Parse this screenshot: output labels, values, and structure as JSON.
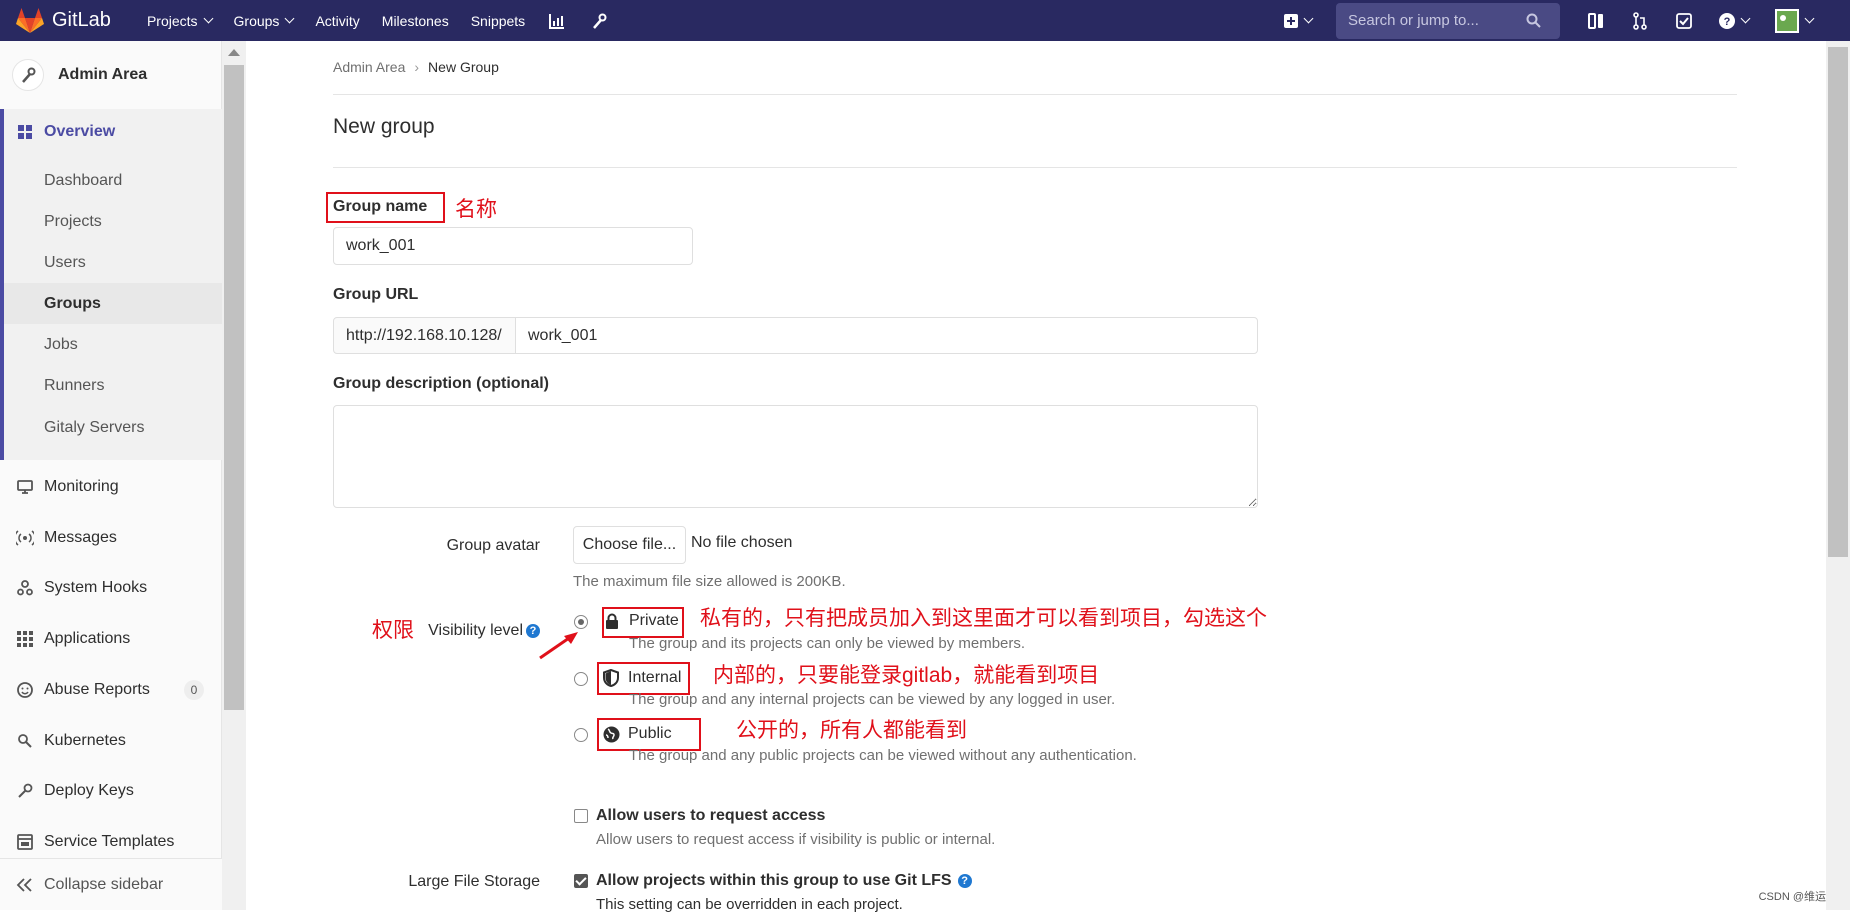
{
  "navbar": {
    "brand": "GitLab",
    "links": [
      "Projects",
      "Groups",
      "Activity",
      "Milestones",
      "Snippets"
    ],
    "search_placeholder": "Search or jump to..."
  },
  "sidebar": {
    "title": "Admin Area",
    "overview": "Overview",
    "sub_items": [
      "Dashboard",
      "Projects",
      "Users",
      "Groups",
      "Jobs",
      "Runners",
      "Gitaly Servers"
    ],
    "items": [
      "Monitoring",
      "Messages",
      "System Hooks",
      "Applications",
      "Abuse Reports",
      "Kubernetes",
      "Deploy Keys",
      "Service Templates"
    ],
    "abuse_count": "0",
    "collapse": "Collapse sidebar"
  },
  "breadcrumb": {
    "parent": "Admin Area",
    "current": "New Group"
  },
  "page_title": "New group",
  "form": {
    "group_name_label": "Group name",
    "group_name_value": "work_001",
    "group_url_label": "Group URL",
    "group_url_prefix": "http://192.168.10.128/",
    "group_url_value": "work_001",
    "description_label": "Group description (optional)",
    "avatar_label": "Group avatar",
    "choose_file": "Choose file...",
    "no_file": "No file chosen",
    "file_help": "The maximum file size allowed is 200KB.",
    "visibility_label": "Visibility level",
    "private_label": "Private",
    "private_help": "The group and its projects can only be viewed by members.",
    "internal_label": "Internal",
    "internal_help": "The group and any internal projects can be viewed by any logged in user.",
    "public_label": "Public",
    "public_help": "The group and any public projects can be viewed without any authentication.",
    "request_access_label": "Allow users to request access",
    "request_access_help": "Allow users to request access if visibility is public or internal.",
    "lfs_section_label": "Large File Storage",
    "lfs_label": "Allow projects within this group to use Git LFS",
    "lfs_help": "This setting can be overridden in each project."
  },
  "annotations": {
    "name": "名称",
    "permission": "权限",
    "private": "私有的，只有把成员加入到这里面才可以看到项目，勾选这个",
    "internal": "内部的，只要能登录gitlab，就能看到项目",
    "public": "公开的，所有人都能看到"
  },
  "watermark": "CSDN @维运",
  "colors": {
    "navbar": "#292961",
    "annotation": "#e0101a",
    "accent": "#4b4ba3"
  }
}
